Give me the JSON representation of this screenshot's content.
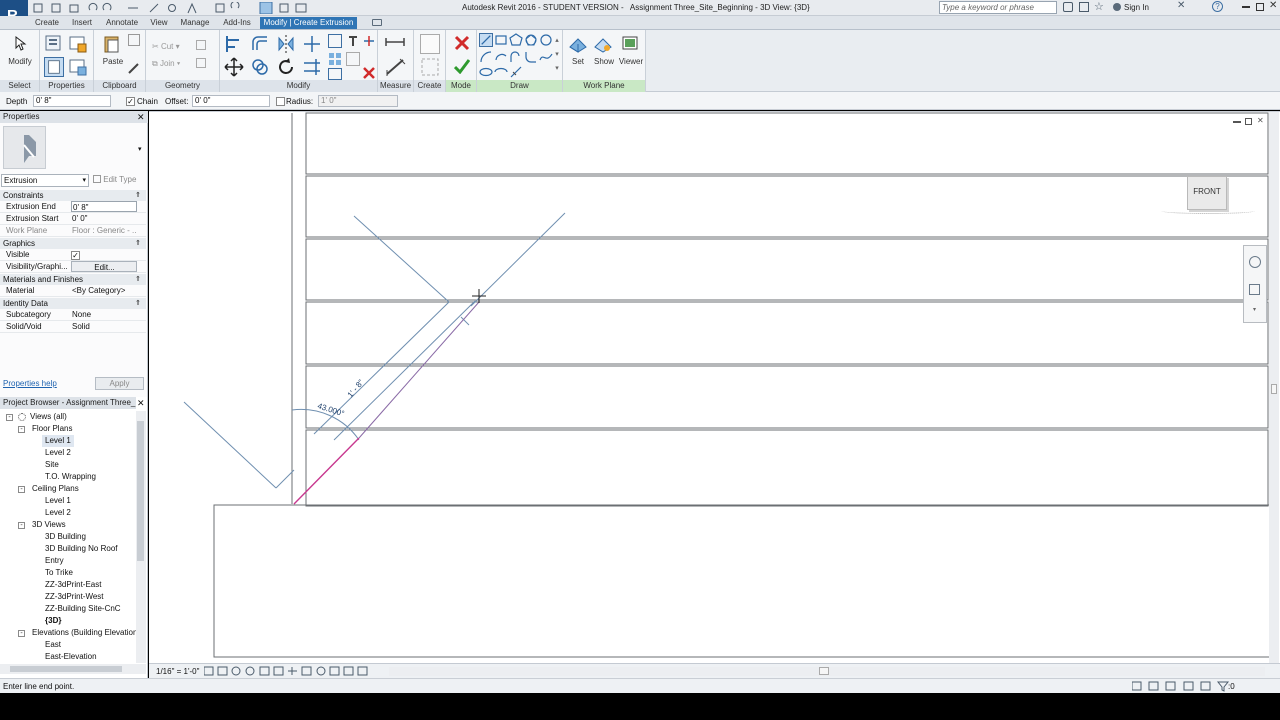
{
  "title": {
    "app_title": "Autodesk Revit 2016 - STUDENT VERSION -   Assignment Three_Site_Beginning - 3D View: {3D}",
    "search_placeholder": "Type a keyword or phrase",
    "sign_in": "Sign In"
  },
  "tabs": [
    "Create",
    "Insert",
    "Annotate",
    "View",
    "Manage",
    "Add-Ins",
    "Modify | Create Extrusion"
  ],
  "ribbon": {
    "modify_label": "Modify",
    "paste_label": "Paste",
    "cut_label": "Cut",
    "join_label": "Join",
    "set_label": "Set",
    "show_label": "Show",
    "viewer_label": "Viewer",
    "panels": {
      "select": "Select",
      "properties": "Properties",
      "clipboard": "Clipboard",
      "geometry": "Geometry",
      "modify": "Modify",
      "measure": "Measure",
      "create": "Create",
      "mode": "Mode",
      "draw": "Draw",
      "work_plane": "Work Plane"
    }
  },
  "options": {
    "depth_label": "Depth",
    "depth_value": "0'  8\"",
    "chain_label": "Chain",
    "offset_label": "Offset:",
    "offset_value": "0'  0\"",
    "radius_label": "Radius:",
    "radius_value": "1'  0\""
  },
  "properties": {
    "header": "Properties",
    "type": "Extrusion",
    "edit_type": "Edit Type",
    "groups": {
      "constraints": "Constraints",
      "graphics": "Graphics",
      "materials": "Materials and Finishes",
      "identity": "Identity Data"
    },
    "rows": {
      "extrusion_end": {
        "label": "Extrusion End",
        "value": "0'  8\""
      },
      "extrusion_start": {
        "label": "Extrusion Start",
        "value": "0'  0\""
      },
      "work_plane": {
        "label": "Work Plane",
        "value": "Floor : Generic - ..."
      },
      "visible": {
        "label": "Visible"
      },
      "visibility": {
        "label": "Visibility/Graphi...",
        "value": "Edit..."
      },
      "material": {
        "label": "Material",
        "value": "<By Category>"
      },
      "subcategory": {
        "label": "Subcategory",
        "value": "None"
      },
      "solid_void": {
        "label": "Solid/Void",
        "value": "Solid"
      }
    },
    "help_link": "Properties help",
    "apply": "Apply"
  },
  "browser": {
    "header": "Project Browser - Assignment Three_...",
    "items": [
      {
        "label": "Views (all)",
        "indent": 0,
        "toggle": "-"
      },
      {
        "label": "Floor Plans",
        "indent": 1,
        "toggle": "-"
      },
      {
        "label": "Level 1",
        "indent": 2,
        "selected": true
      },
      {
        "label": "Level 2",
        "indent": 2
      },
      {
        "label": "Site",
        "indent": 2
      },
      {
        "label": "T.O. Wrapping",
        "indent": 2
      },
      {
        "label": "Ceiling Plans",
        "indent": 1,
        "toggle": "-"
      },
      {
        "label": "Level 1",
        "indent": 2
      },
      {
        "label": "Level 2",
        "indent": 2
      },
      {
        "label": "3D Views",
        "indent": 1,
        "toggle": "-"
      },
      {
        "label": "3D Building",
        "indent": 2
      },
      {
        "label": "3D Building No Roof",
        "indent": 2
      },
      {
        "label": "Entry",
        "indent": 2
      },
      {
        "label": "To Trike",
        "indent": 2
      },
      {
        "label": "ZZ-3dPrint-East",
        "indent": 2
      },
      {
        "label": "ZZ-3dPrint-West",
        "indent": 2
      },
      {
        "label": "ZZ-Building Site-CnC",
        "indent": 2
      },
      {
        "label": "{3D}",
        "indent": 2,
        "bold": true
      },
      {
        "label": "Elevations (Building Elevation",
        "indent": 1,
        "toggle": "-"
      },
      {
        "label": "East",
        "indent": 2
      },
      {
        "label": "East-Elevation",
        "indent": 2
      }
    ]
  },
  "canvas": {
    "dim_length": "1' - 8\"",
    "dim_angle": "43.000°",
    "viewcube_label": "FRONT"
  },
  "view_bar": {
    "scale": "1/16\" = 1'-0\""
  },
  "status": {
    "text": "Enter line end point.",
    "filter_count": ":0"
  },
  "colors": {
    "context_tab": "#2f75b5",
    "sketch_line": "#c8388f",
    "selection": "#6f8fb0"
  }
}
